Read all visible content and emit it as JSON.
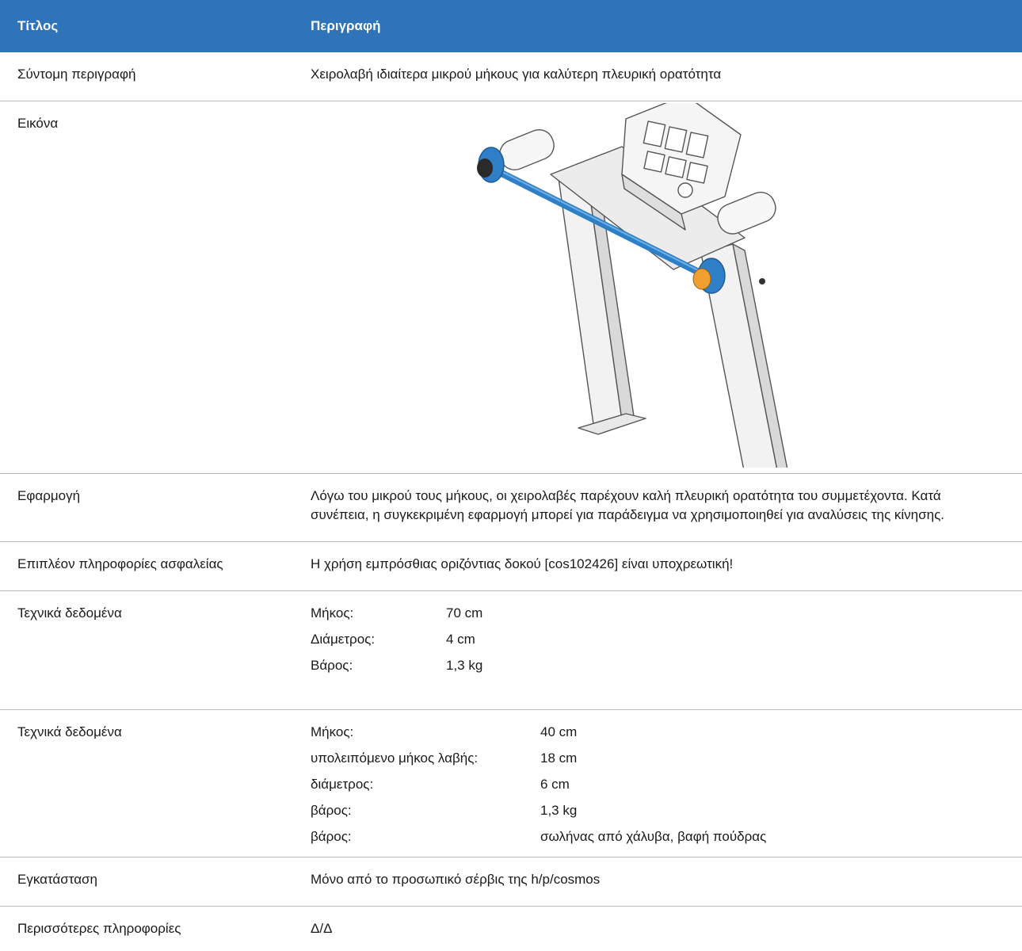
{
  "header": {
    "col1": "Τίτλος",
    "col2": "Περιγραφή"
  },
  "rows": {
    "short_description": {
      "label": "Σύντομη περιγραφή",
      "value": "Χειρολαβή ιδιαίτερα μικρού μήκους για καλύτερη πλευρική ορατότητα"
    },
    "image": {
      "label": "Εικόνα"
    },
    "application": {
      "label": "Εφαρμογή",
      "line1": "Λόγω του μικρού τους μήκους, οι χειρολαβές παρέχουν καλή πλευρική ορατότητα του συμμετέχοντα. Κατά",
      "line2": "συνέπεια, η συγκεκριμένη εφαρμογή μπορεί για παράδειγμα να χρησιμοποιηθεί για αναλύσεις της κίνησης."
    },
    "safety": {
      "label": "Επιπλέον πληροφορίες ασφαλείας",
      "value": "Η χρήση εμπρόσθιας οριζόντιας δοκού [cos102426] είναι υποχρεωτική!"
    },
    "tech1": {
      "label": "Τεχνικά δεδομένα",
      "specs": [
        {
          "k": "Μήκος:",
          "v": "70 cm"
        },
        {
          "k": "Διάμετρος:",
          "v": "4 cm"
        },
        {
          "k": "Βάρος:",
          "v": "1,3 kg"
        }
      ]
    },
    "tech2": {
      "label": "Τεχνικά δεδομένα",
      "specs": [
        {
          "k": "Μήκος:",
          "v": "40 cm"
        },
        {
          "k": "υπολειπόμενο μήκος λαβής:",
          "v": "18 cm"
        },
        {
          "k": "διάμετρος:",
          "v": "6 cm"
        },
        {
          "k": "βάρος:",
          "v": "1,3 kg"
        },
        {
          "k": "βάρος:",
          "v": "σωλήνας από χάλυβα, βαφή πούδρας"
        }
      ]
    },
    "installation": {
      "label": "Εγκατάσταση",
      "value": "Μόνο από το προσωπικό σέρβις της h/p/cosmos"
    },
    "more_info": {
      "label": "Περισσότερες πληροφορίες",
      "value": "Δ/Δ"
    }
  },
  "colors": {
    "header_bg": "#2f74b9",
    "accent_blue": "#2f7fc8",
    "accent_orange": "#f0a030"
  }
}
